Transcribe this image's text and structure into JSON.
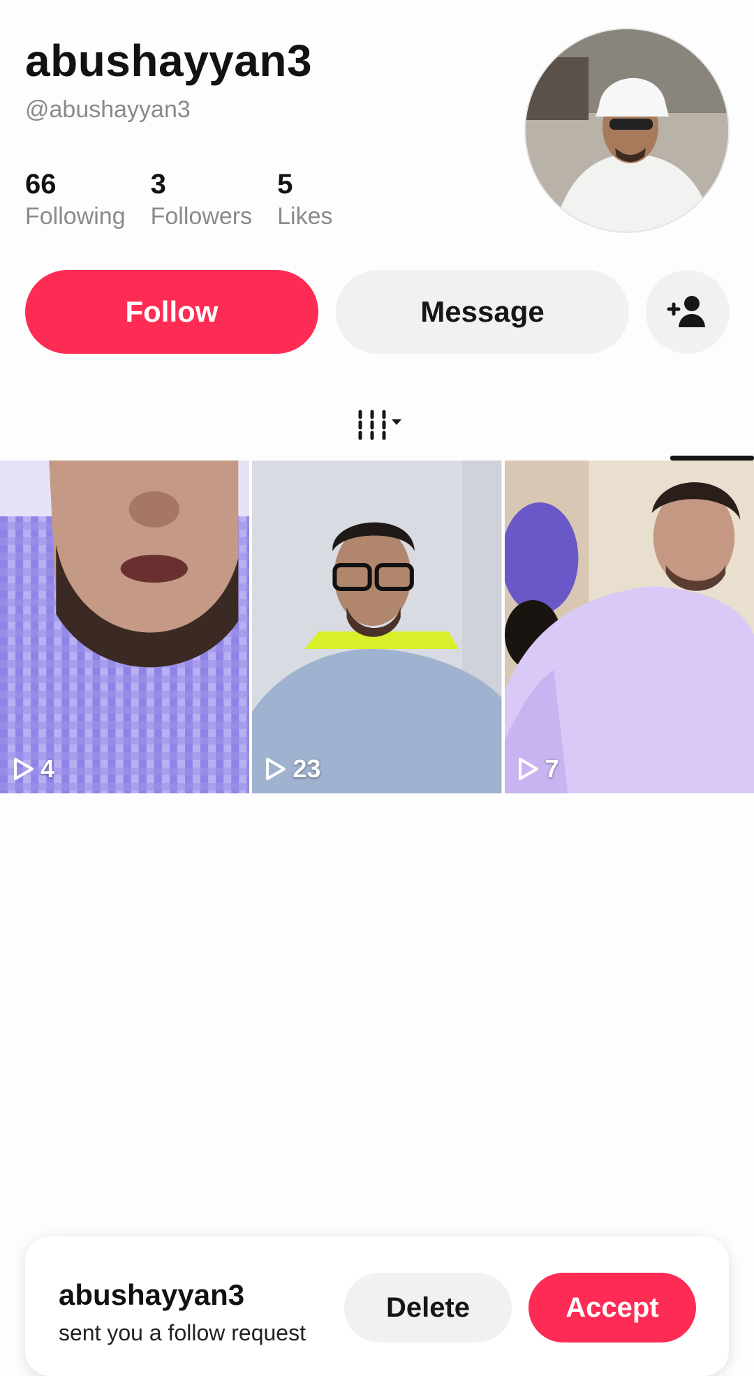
{
  "profile": {
    "display_name": "abushayyan3",
    "handle": "@abushayyan3",
    "stats": [
      {
        "value": "66",
        "label": "Following"
      },
      {
        "value": "3",
        "label": "Followers"
      },
      {
        "value": "5",
        "label": "Likes"
      }
    ]
  },
  "actions": {
    "follow_label": "Follow",
    "message_label": "Message"
  },
  "videos": [
    {
      "views": "4"
    },
    {
      "views": "23"
    },
    {
      "views": "7"
    }
  ],
  "follow_request": {
    "name": "abushayyan3",
    "text": "sent you a follow request",
    "delete_label": "Delete",
    "accept_label": "Accept"
  },
  "colors": {
    "accent": "#fe2c55",
    "secondary_button": "#f1f1f2",
    "muted_text": "#8a8a8a"
  }
}
